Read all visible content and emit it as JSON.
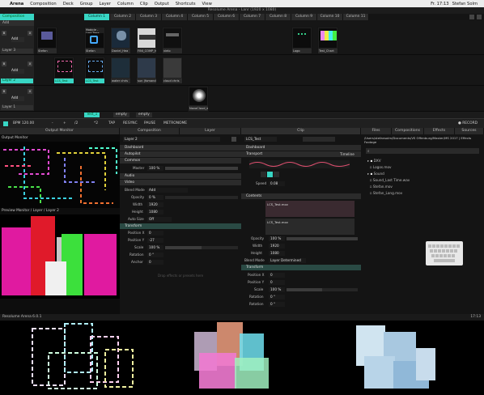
{
  "menubar": {
    "apple": "",
    "app": "Arena",
    "items": [
      "Composition",
      "Deck",
      "Group",
      "Layer",
      "Column",
      "Clip",
      "Output",
      "Shortcuts",
      "View"
    ],
    "clock": "Fr. 17:13",
    "user": "Stefan Solm"
  },
  "window": {
    "title": "Resolume Arena - Lanr (1920 x 1080)"
  },
  "deck": {
    "label": "Composition"
  },
  "columns": [
    "Column 1",
    "Column 2",
    "Column 3",
    "Column 4",
    "Column 5",
    "Column 6",
    "Column 7",
    "Column 8",
    "Column 9",
    "Column 10",
    "Column 11"
  ],
  "layers": [
    {
      "name": "Layer 4",
      "add": "Add",
      "clips": []
    },
    {
      "name": "Layer 3",
      "add": "Add",
      "clips": [
        "Stefan",
        "Stefan",
        "Daniel_Hea",
        "FINI_COMP_hio",
        "vielo",
        "",
        "",
        "",
        "Logo",
        "Test_Chart"
      ]
    },
    {
      "name": "Layer 2",
      "add": "Add",
      "clips": [
        "LCS_Test",
        "LCS_Test",
        "water chris",
        "sun (fomanden)",
        "cloud chris"
      ]
    },
    {
      "name": "Layer 1",
      "add": "Add",
      "clips": [
        "",
        "",
        "",
        "",
        "",
        "NovaCloud_wall"
      ]
    }
  ],
  "layer_buttons": [
    "B",
    "S",
    "X"
  ],
  "clip_thumb_label": "Mobicle - Last Time",
  "comp_tabs": [
    "Test_1",
    "empty",
    "empty"
  ],
  "transport": {
    "bpm": "BPM 120.00",
    "buttons": [
      "-",
      "+",
      "/2",
      "*2",
      "TAP",
      "RESYNC",
      "PAUSE",
      "METRONOME"
    ],
    "record": "● RECORD"
  },
  "panels": {
    "output_monitor": "Output Monitor",
    "output_title": "Output Monitor",
    "preview_title": "Preview Monitor / Layer / Layer 2",
    "composition": "Composition",
    "layer": "Layer",
    "clip": "Clip",
    "files": "Files",
    "compositions": "Compositions",
    "effects": "Effects",
    "sources": "Sources"
  },
  "layer_panel": {
    "name": "Layer 2",
    "sections": [
      "Dashboard",
      "Autopilot",
      "Common",
      "Audio",
      "Video",
      "Transform"
    ],
    "master_label": "Master",
    "master_val": "100 %",
    "blend_label": "Blend Mode",
    "blend_val": "Add",
    "opacity_label": "Opacity",
    "opacity_val": "0 %",
    "width_label": "Width",
    "width_val": "1920",
    "height_label": "Height",
    "height_val": "1080",
    "autosize_label": "Auto Size",
    "autosize_val": "Off",
    "posx_label": "Position X",
    "posx_val": "0",
    "posy_label": "Position Y",
    "posy_val": "-27",
    "scale_label": "Scale",
    "scale_val": "100 %",
    "rot_label": "Rotation",
    "rot_val": "0 °",
    "anchor_label": "Anchor",
    "anchor_val": "0",
    "dropzone": "Drop effects or presets here"
  },
  "clip_panel": {
    "name": "LCS_Test",
    "dashboard": "Dashboard",
    "transport": "Transport",
    "timeline": "Timeline",
    "speed_label": "Speed",
    "speed_val": "0.08",
    "contents": "Contents",
    "audio_file": "LCS_Test.mov",
    "video_file": "LCS_Test.mov",
    "opacity_label": "Opacity",
    "opacity_val": "100 %",
    "width_label": "Width",
    "width_val": "1920",
    "height_label": "Height",
    "height_val": "1080",
    "blend_label": "Blend Mode",
    "blend_val": "Layer Determined",
    "transform": "Transform",
    "posx_label": "Position X",
    "posx_val": "0",
    "posy_label": "Position Y",
    "posy_val": "0",
    "scale_label": "Scale",
    "scale_val": "100 %",
    "rotx_label": "Rotation",
    "rotx_val": "0 °",
    "roty_label": "Rotation",
    "roty_val": "0 °"
  },
  "files_panel": {
    "path": "/Users/stefansolm/Documents/VS Offenburg/Master/MS 2017 | Effects Footage",
    "items": [
      "DXV",
      "Logos.mov",
      "Sound",
      "Sound_Last Time.wav",
      "Stefan.mov",
      "Stefan_Lang.mov"
    ]
  },
  "status": {
    "app": "Resolume Arena 6.0.1",
    "time": "17:13"
  }
}
